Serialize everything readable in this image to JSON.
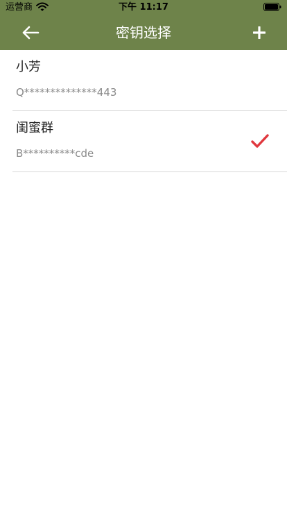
{
  "status_bar": {
    "carrier": "运营商",
    "time": "下午 11:17"
  },
  "nav": {
    "title": "密钥选择",
    "back_icon": "arrow-left-icon",
    "add_icon": "plus-icon"
  },
  "keys": [
    {
      "name": "小芳",
      "key": "Q**************443",
      "selected": false
    },
    {
      "name": "闺蜜群",
      "key": "B**********cde",
      "selected": true
    }
  ],
  "colors": {
    "nav_background": "#6e834a",
    "check": "#e0383e"
  }
}
